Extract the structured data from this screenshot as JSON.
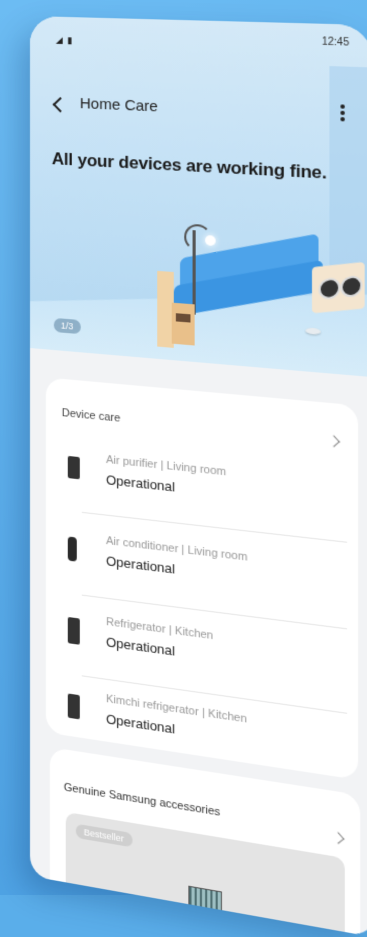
{
  "status_bar": {
    "time": "12:45",
    "icons": "◢ ▮"
  },
  "header": {
    "title": "Home Care",
    "headline": "All your devices are working fine."
  },
  "hero": {
    "page_indicator": "1/3"
  },
  "device_care": {
    "title": "Device care",
    "devices": [
      {
        "meta": "Air purifier | Living room",
        "status": "Operational",
        "icon": "air-purifier-icon"
      },
      {
        "meta": "Air conditioner | Living room",
        "status": "Operational",
        "icon": "air-conditioner-icon"
      },
      {
        "meta": "Refrigerator | Kitchen",
        "status": "Operational",
        "icon": "refrigerator-icon"
      },
      {
        "meta": "Kimchi refrigerator | Kitchen",
        "status": "Operational",
        "icon": "kimchi-refrigerator-icon"
      }
    ]
  },
  "accessories": {
    "title": "Genuine Samsung accessories",
    "badge": "Bestseller"
  }
}
